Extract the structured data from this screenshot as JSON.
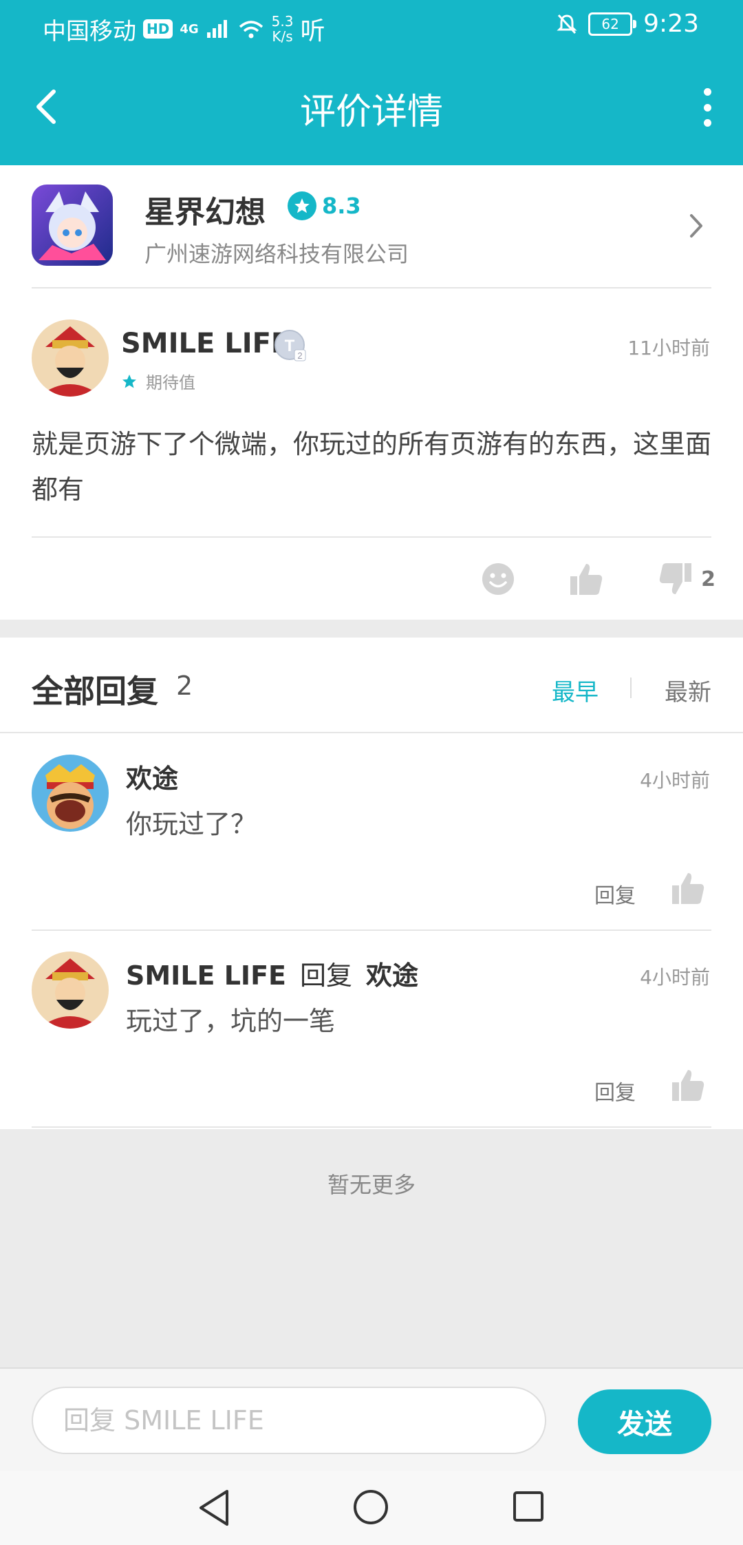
{
  "status_bar": {
    "carrier": "中国移动",
    "hd": "HD",
    "net": "4G",
    "speed_value": "5.3",
    "speed_unit": "K/s",
    "listen": "听",
    "battery": "62",
    "time": "9:23"
  },
  "header": {
    "title": "评价详情"
  },
  "game": {
    "name": "星界幻想",
    "rating": "8.3",
    "company": "广州速游网络科技有限公司"
  },
  "review": {
    "author": "SMILE LIFE",
    "time": "11小时前",
    "expectation_label": "期待值",
    "text": "就是页游下了个微端，你玩过的所有页游有的东西，这里面都有",
    "dislike_count": "2"
  },
  "replies_section": {
    "title": "全部回复",
    "count": "2",
    "sort_earliest": "最早",
    "sort_newest": "最新",
    "items": [
      {
        "author": "欢途",
        "time": "4小时前",
        "text": "你玩过了？",
        "reply_label": "回复"
      },
      {
        "author": "SMILE LIFE",
        "reply_to_word": "回复",
        "reply_to": "欢途",
        "time": "4小时前",
        "text": "玩过了，坑的一笔",
        "reply_label": "回复"
      }
    ],
    "no_more": "暂无更多"
  },
  "composer": {
    "placeholder": "回复 SMILE LIFE",
    "send_label": "发送"
  },
  "colors": {
    "accent": "#15b7c8"
  }
}
